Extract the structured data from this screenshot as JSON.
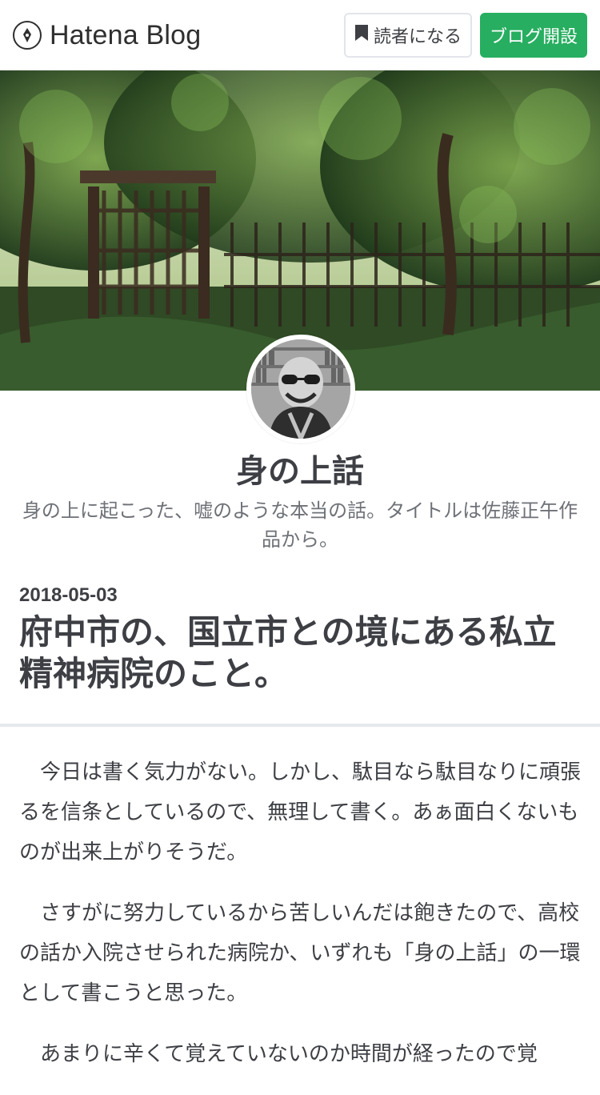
{
  "header": {
    "brand": "Hatena Blog",
    "reader_button": "読者になる",
    "open_blog_button": "ブログ開設",
    "colors": {
      "open_blog_bg": "#27ae60"
    }
  },
  "hero": {
    "image": "garden-gate-photo"
  },
  "blog": {
    "title": "身の上話",
    "description": "身の上に起こった、嘘のような本当の話。タイトルは佐藤正午作品から。"
  },
  "entry": {
    "date": "2018-05-03",
    "title": "府中市の、国立市との境にある私立精神病院のこと。",
    "paragraphs": [
      "今日は書く気力がない。しかし、駄目なら駄目なりに頑張るを信条としているので、無理して書く。あぁ面白くないものが出来上がりそうだ。",
      "さすがに努力しているから苦しいんだは飽きたので、高校の話か入院させられた病院か、いずれも「身の上話」の一環として書こうと思った。",
      "あまりに辛くて覚えていないのか時間が経ったので覚"
    ]
  }
}
